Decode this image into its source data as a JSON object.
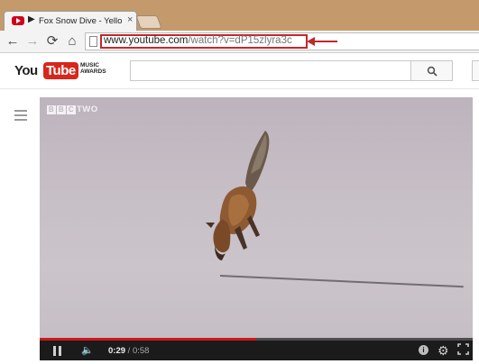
{
  "browser": {
    "tab": {
      "title": "Fox Snow Dive - Yellow",
      "speaker_glyph": "▶",
      "close_glyph": "×"
    },
    "nav": {
      "back_glyph": "←",
      "forward_glyph": "→",
      "reload_glyph": "⟳",
      "home_glyph": "⌂"
    },
    "address": {
      "host": "www.youtube.com",
      "path": "/watch?v=dP15zlyra3c"
    },
    "annotation_color": "#c0282d"
  },
  "youtube": {
    "logo": {
      "you": "You",
      "tube": "Tube",
      "awards": "MUSIC AWARDS"
    },
    "search": {
      "placeholder": ""
    }
  },
  "player": {
    "channel_logo": {
      "letters": [
        "B",
        "B",
        "C"
      ],
      "suffix": "TWO"
    },
    "current_time": "0:29",
    "separator": " / ",
    "duration": "0:58",
    "progress_fraction": 0.5,
    "info_glyph": "i",
    "gear_glyph": "⚙",
    "volume_glyph": "🔈"
  }
}
